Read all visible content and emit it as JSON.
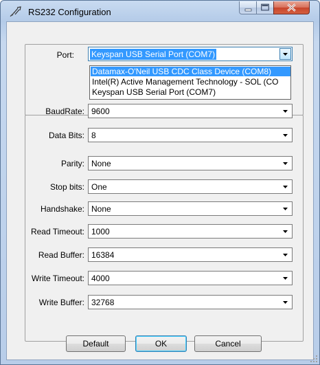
{
  "window": {
    "title": "RS232 Configuration",
    "icon": "serial-plug-icon"
  },
  "port": {
    "label": "Port:",
    "value": "Keyspan USB Serial Port (COM7)",
    "options": [
      "Datamax-O'Neil USB CDC Class Device (COM8)",
      "Intel(R) Active Management Technology - SOL (CO",
      "Keyspan USB Serial Port (COM7)"
    ],
    "highlighted_index": 0
  },
  "fields": [
    {
      "label": "BaudRate:",
      "value": "9600"
    },
    {
      "label": "Data Bits:",
      "value": "8"
    },
    {
      "label": "Parity:",
      "value": "None"
    },
    {
      "label": "Stop bits:",
      "value": "One"
    },
    {
      "label": "Handshake:",
      "value": "None"
    },
    {
      "label": "Read Timeout:",
      "value": "1000"
    },
    {
      "label": "Read Buffer:",
      "value": "16384"
    },
    {
      "label": "Write Timeout:",
      "value": "4000"
    },
    {
      "label": "Write Buffer:",
      "value": "32768"
    }
  ],
  "buttons": {
    "default": "Default",
    "ok": "OK",
    "cancel": "Cancel"
  },
  "colors": {
    "highlight": "#3399ff",
    "close_button": "#c7452c",
    "title_bar": "#b4cbe8"
  }
}
